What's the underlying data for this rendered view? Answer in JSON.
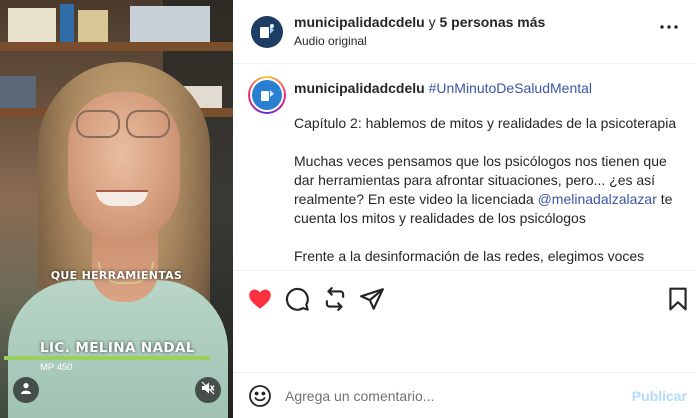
{
  "video": {
    "caption": "QUE HERRAMIENTAS",
    "name_tag": "LIC. MELINA NADAL",
    "registration": "MP 450",
    "profile_icon": "user-icon",
    "mute_icon": "speaker-muted-icon",
    "name_bar_color": "#9ad05c"
  },
  "header": {
    "username": "municipalidadcdelu",
    "connector": " y ",
    "others": "5 personas más",
    "audio": "Audio original",
    "more_icon": "more-dots-icon"
  },
  "post": {
    "username": "municipalidadcdelu",
    "hashtag": "#UnMinutoDeSaludMental",
    "chapter": "Capítulo 2: hablemos de mitos y realidades de la psicoterapia",
    "para2_start": "Muchas veces pensamos que los psicólogos nos tienen que dar herramientas para afrontar situaciones, pero... ¿es así realmente? En este video la licenciada ",
    "mention": "@melinadalzalazar",
    "para2_end": " te cuenta los mitos y realidades de los psicólogos",
    "para3": "Frente a la desinformación de las redes, elegimos voces expertas. Porque hablar hace bien, pero escuchar a los que saben, hace mucho más."
  },
  "actions": {
    "like_icon": "heart-filled-icon",
    "comment_icon": "comment-icon",
    "share_icon": "repost-icon",
    "send_icon": "send-icon",
    "save_icon": "bookmark-icon",
    "like_color": "#ff3040"
  },
  "footer": {
    "emoji_icon": "emoji-icon",
    "placeholder": "Agrega un comentario...",
    "publish": "Publicar",
    "publish_color": "#b3dbff"
  }
}
